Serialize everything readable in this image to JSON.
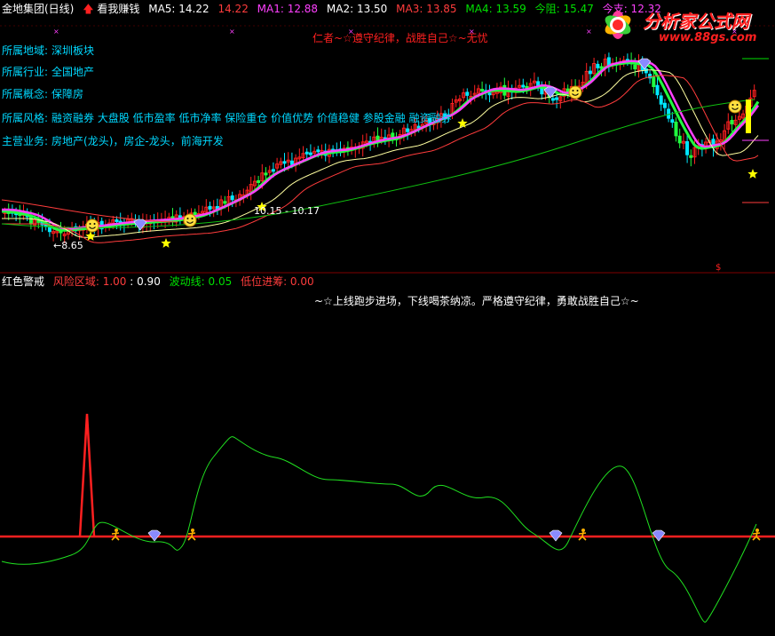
{
  "header": {
    "stock_name": "金地集团(日线)",
    "indicator_name": "看我赚钱",
    "ma5_label": "MA5: 14.22",
    "ma5_extra": "14.22",
    "ma1_label": "MA1: 12.88",
    "ma2_label": "MA2: 13.50",
    "ma3_label": "MA3: 13.85",
    "ma4_label": "MA4: 13.59",
    "resist_label": "今阻: 15.47",
    "support_label": "今支: 12.32"
  },
  "colors": {
    "ma5": "#ffffff",
    "ma5_extra": "#ff3c3c",
    "ma1": "#ff40ff",
    "ma2": "#ffffff",
    "ma3": "#ff3c3c",
    "ma4": "#00e000",
    "resist": "#00e000",
    "support": "#ff40ff",
    "info": "#00d8ff",
    "up": "#ff2020",
    "down": "#00e8ff",
    "grid": "#800000"
  },
  "info_rows": [
    {
      "key": "所属地域:",
      "value": "深圳板块"
    },
    {
      "key": "所属行业:",
      "value": "全国地产"
    },
    {
      "key": "所属概念:",
      "value": "保障房"
    },
    {
      "key": "所属风格:",
      "value": "融资融券 大盘股 低市盈率 低市净率 保险重仓 价值优势 价值稳健 参股金融 融资融券"
    },
    {
      "key": "主营业务:",
      "value": "房地产(龙头)，房企-龙头，前海开发"
    }
  ],
  "chart_annotations": {
    "motto": "仁者~☆遵守纪律，战胜自己☆~无忧",
    "low_price": "8.65",
    "range_label": "10.15 - 10.17"
  },
  "logo": {
    "cn": "分析家公式网",
    "url": "www.88gs.com"
  },
  "sub_indicator": {
    "name": "红色警戒",
    "risk_label": "风险区域: 1.00",
    "risk_val2": ": 0.90",
    "wave_label": "波动线: 0.05",
    "low_label": "低位进筹: 0.00",
    "slogan": "~☆上线跑步进场，下线喝茶纳凉。严格遵守纪律，勇敢战胜自己☆~"
  }
}
